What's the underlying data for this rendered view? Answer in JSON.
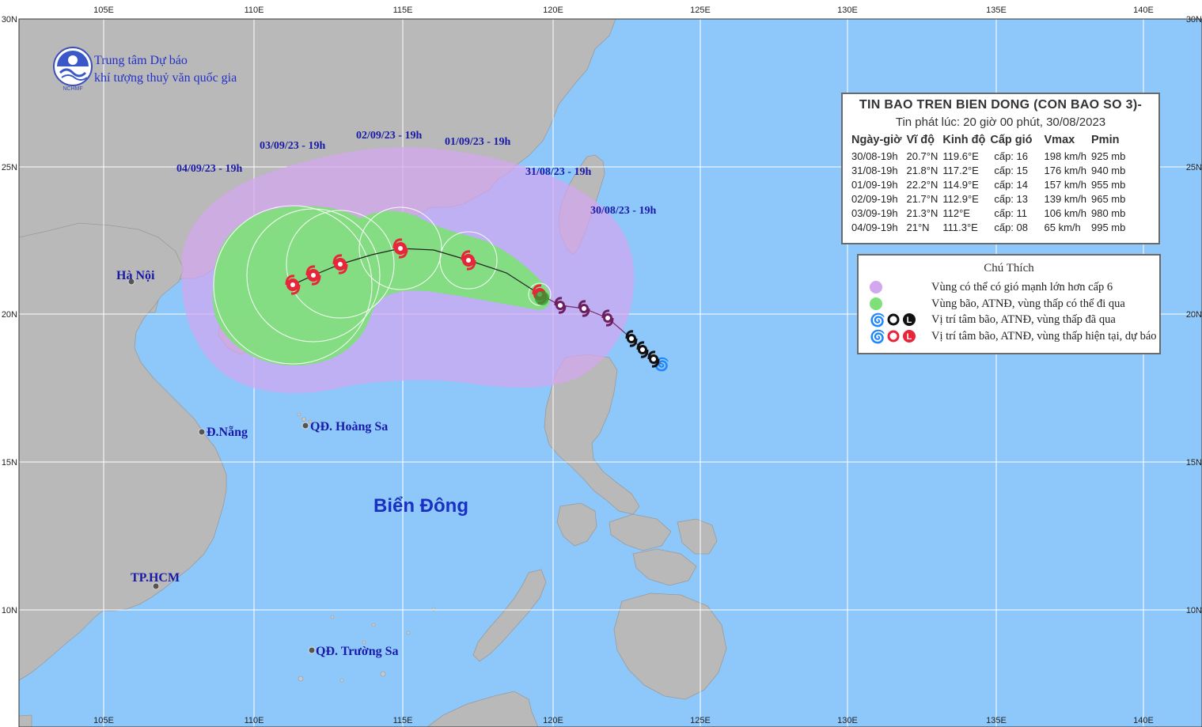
{
  "org": {
    "line1": "Trung tâm Dự báo",
    "line2": "khí tượng thuỷ văn quốc gia",
    "logo_text": "NCHMF"
  },
  "axes": {
    "longitudes": [
      "105E",
      "110E",
      "115E",
      "120E",
      "125E",
      "130E",
      "135E",
      "140E"
    ],
    "latitudes": [
      "25N",
      "20N",
      "15N",
      "10N"
    ],
    "corner_label": "30N"
  },
  "bulletin": {
    "title": "TIN BAO TREN BIEN DONG (CON BAO SO 3)-",
    "issued": "Tin phát lúc: 20 giờ 00 phút, 30/08/2023",
    "headers": [
      "Ngày-giờ",
      "Vĩ độ",
      "Kinh độ",
      "Cấp gió",
      "Vmax",
      "Pmin"
    ],
    "rows": [
      [
        "30/08-19h",
        "20.7°N",
        "119.6°E",
        "cấp: 16",
        "198 km/h",
        "925 mb"
      ],
      [
        "31/08-19h",
        "21.8°N",
        "117.2°E",
        "cấp: 15",
        "176 km/h",
        "940 mb"
      ],
      [
        "01/09-19h",
        "22.2°N",
        "114.9°E",
        "cấp: 14",
        "157 km/h",
        "955 mb"
      ],
      [
        "02/09-19h",
        "21.7°N",
        "112.9°E",
        "cấp: 13",
        "139 km/h",
        "965 mb"
      ],
      [
        "03/09-19h",
        "21.3°N",
        "112°E",
        "cấp: 11",
        "106 km/h",
        "980 mb"
      ],
      [
        "04/09-19h",
        "21°N",
        "111.3°E",
        "cấp: 08",
        "65 km/h",
        "995 mb"
      ]
    ]
  },
  "legend": {
    "title": "Chú Thích",
    "items": [
      "Vùng có thể có gió mạnh lớn hơn cấp 6",
      "Vùng bão, ATNĐ, vùng thấp có thể đi qua",
      "Vị trí tâm bão, ATNĐ, vùng thấp đã qua",
      "Vị trí tâm bão, ATNĐ, vùng thấp hiện tại, dự báo"
    ],
    "colors": {
      "strong_wind_zone": "#d9a6e6",
      "storm_zone": "#7de07a",
      "past_position": "#111111",
      "forecast_position": "#e8263a"
    }
  },
  "track_dates": [
    "30/08/23 - 19h",
    "31/08/23 - 19h",
    "01/09/23 - 19h",
    "02/09/23 - 19h",
    "03/09/23 - 19h",
    "04/09/23 - 19h"
  ],
  "places": {
    "hanoi": "Hà Nội",
    "danang": "Đ.Nẵng",
    "hoangsa": "QĐ. Hoàng Sa",
    "hcm": "TP.HCM",
    "truongsa": "QĐ. Trường Sa",
    "sea": "Biển Đông"
  },
  "colors": {
    "sea": "#8ec8fb",
    "land": "#b9b9b9",
    "grid": "#ffffff"
  }
}
